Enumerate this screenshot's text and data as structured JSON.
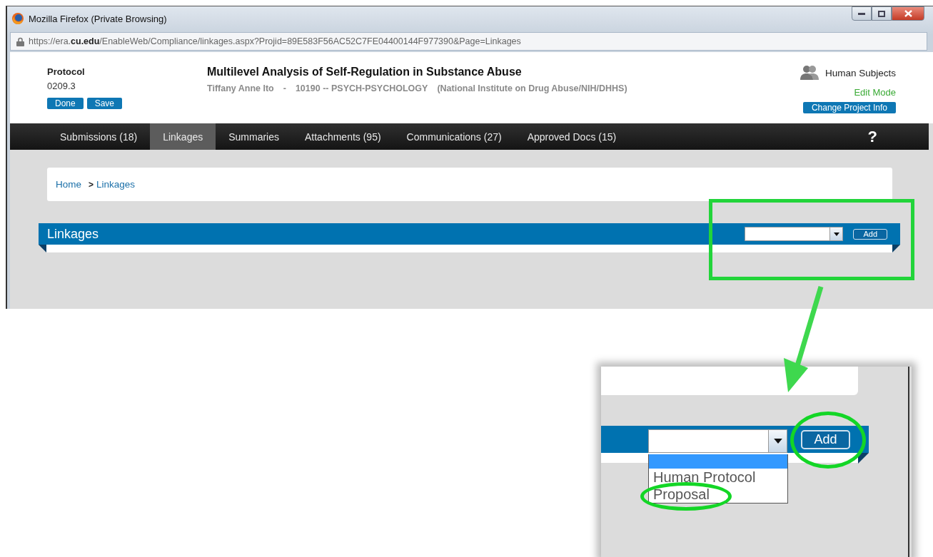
{
  "window": {
    "title": "Mozilla Firefox (Private Browsing)",
    "url": "https://era.**cu.edu**/EnableWeb/Compliance/linkages.aspx?Projid=89E583F56AC52C7FE04400144F977390&Page=Linkages"
  },
  "header": {
    "protocol_label": "Protocol",
    "protocol_number": "0209.3",
    "buttons": [
      "Done",
      "Save"
    ],
    "title": "Multilevel Analysis of Self-Regulation in Substance Abuse",
    "subtitle": [
      "Tiffany Anne Ito",
      "-",
      "10190 -- PSYCH-PSYCHOLOGY",
      "(National Institute on Drug Abuse/NIH/DHHS)"
    ],
    "project_type": "Human Subjects",
    "mode": "Edit Mode",
    "change_button": "Change Project Info"
  },
  "tabs": [
    {
      "label": "Submissions (18)",
      "selected": false
    },
    {
      "label": "Linkages",
      "selected": true
    },
    {
      "label": "Summaries",
      "selected": false
    },
    {
      "label": "Attachments (95)",
      "selected": false
    },
    {
      "label": "Communications (27)",
      "selected": false
    },
    {
      "label": "Approved Docs (15)",
      "selected": false
    }
  ],
  "help": "?",
  "breadcrumb": {
    "separator": ">",
    "items": [
      "Home",
      "Linkages"
    ]
  },
  "section": {
    "title": "Linkages",
    "add_button": "Add"
  },
  "inset": {
    "add_button": "Add",
    "options": [
      {
        "selected": true
      },
      {
        "label": "Human Protocol",
        "selected": false
      },
      {
        "label": "Proposal",
        "selected": false
      }
    ]
  }
}
